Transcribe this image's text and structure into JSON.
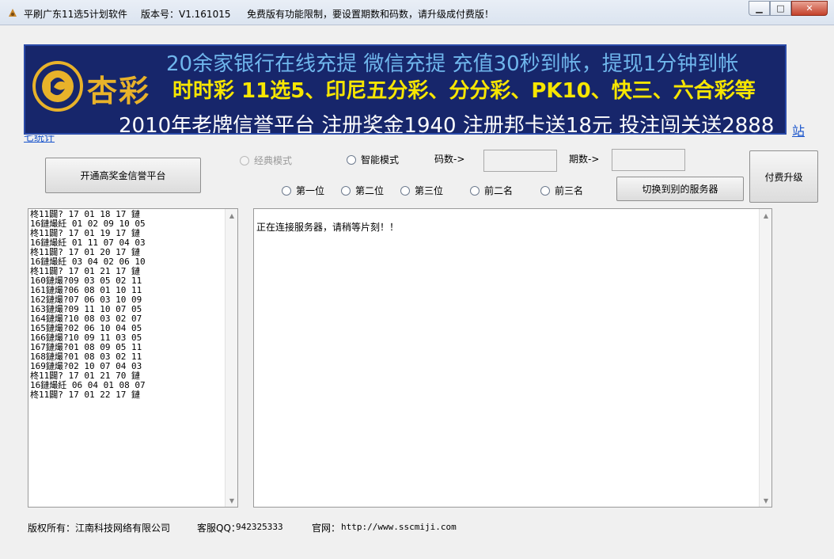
{
  "window": {
    "title": "平刷广东11选5计划软件",
    "version": "版本号：V1.161015",
    "notice": "免费版有功能限制，要设置期数和码数，请升级成付费版！",
    "min_glyph": "▁",
    "max_glyph": "□",
    "close_glyph": "✕"
  },
  "banner": {
    "brand": "杏彩",
    "line1": "20余家银行在线充提 微信充提  充值30秒到帐，提现1分钟到帐",
    "line2": "时时彩 11选5、印尼五分彩、分分彩、PK10、快三、六合彩等",
    "line3": "2010年老牌信誉平台 注册奖金1940    注册邦卡送18元 投注闯关送2888"
  },
  "links": {
    "zhan": "站",
    "stats": "七统计"
  },
  "buttons": {
    "open_platform": "开通高奖金信誉平台",
    "switch_server": "切换到别的服务器",
    "upgrade": "付费升级"
  },
  "modes": {
    "classic": "经典模式",
    "smart": "智能模式"
  },
  "labels": {
    "codes": "码数->",
    "periods": "期数->"
  },
  "positions": [
    "第一位",
    "第二位",
    "第三位",
    "前二名",
    "前三名"
  ],
  "history": [
    "柊11闢? 17 01 18 17 鏈",
    "16鏈熶紝 01 02 09 10 05",
    "柊11闢? 17 01 19 17 鏈",
    "16鏈熶紝 01 11 07 04 03",
    "柊11闢? 17 01 20 17 鏈",
    "16鏈熶紝 03 04 02 06 10",
    "柊11闢? 17 01 21 17 鏈",
    "160鏈熶?09 03 05 02 11",
    "161鏈熶?06 08 01 10 11",
    "162鏈熶?07 06 03 10 09",
    "163鏈熶?09 11 10 07 05",
    "164鏈熶?10 08 03 02 07",
    "165鏈熶?02 06 10 04 05",
    "166鏈熶?10 09 11 03 05",
    "167鏈熶?01 08 09 05 11",
    "168鏈熶?01 08 03 02 11",
    "169鏈熶?02 10 07 04 03",
    "柊11闢? 17 01 21 70 鏈",
    "16鏈熶紝 06 04 01 08 07",
    "柊11闢? 17 01 22 17 鏈"
  ],
  "output": {
    "status": "正在连接服务器，请稍等片刻！！"
  },
  "footer": {
    "copyright": "版权所有：江南科技网络有限公司",
    "qq_label": "客服QQ：",
    "qq": "942325333",
    "site_label": "官网：",
    "site": "http://www.sscmiji.com"
  },
  "colors": {
    "banner_bg": "#17266b",
    "banner_blue": "#6fb6ec",
    "banner_yellow": "#f7e600",
    "brand_gold": "#e8b22a",
    "link": "#1a55cc"
  }
}
